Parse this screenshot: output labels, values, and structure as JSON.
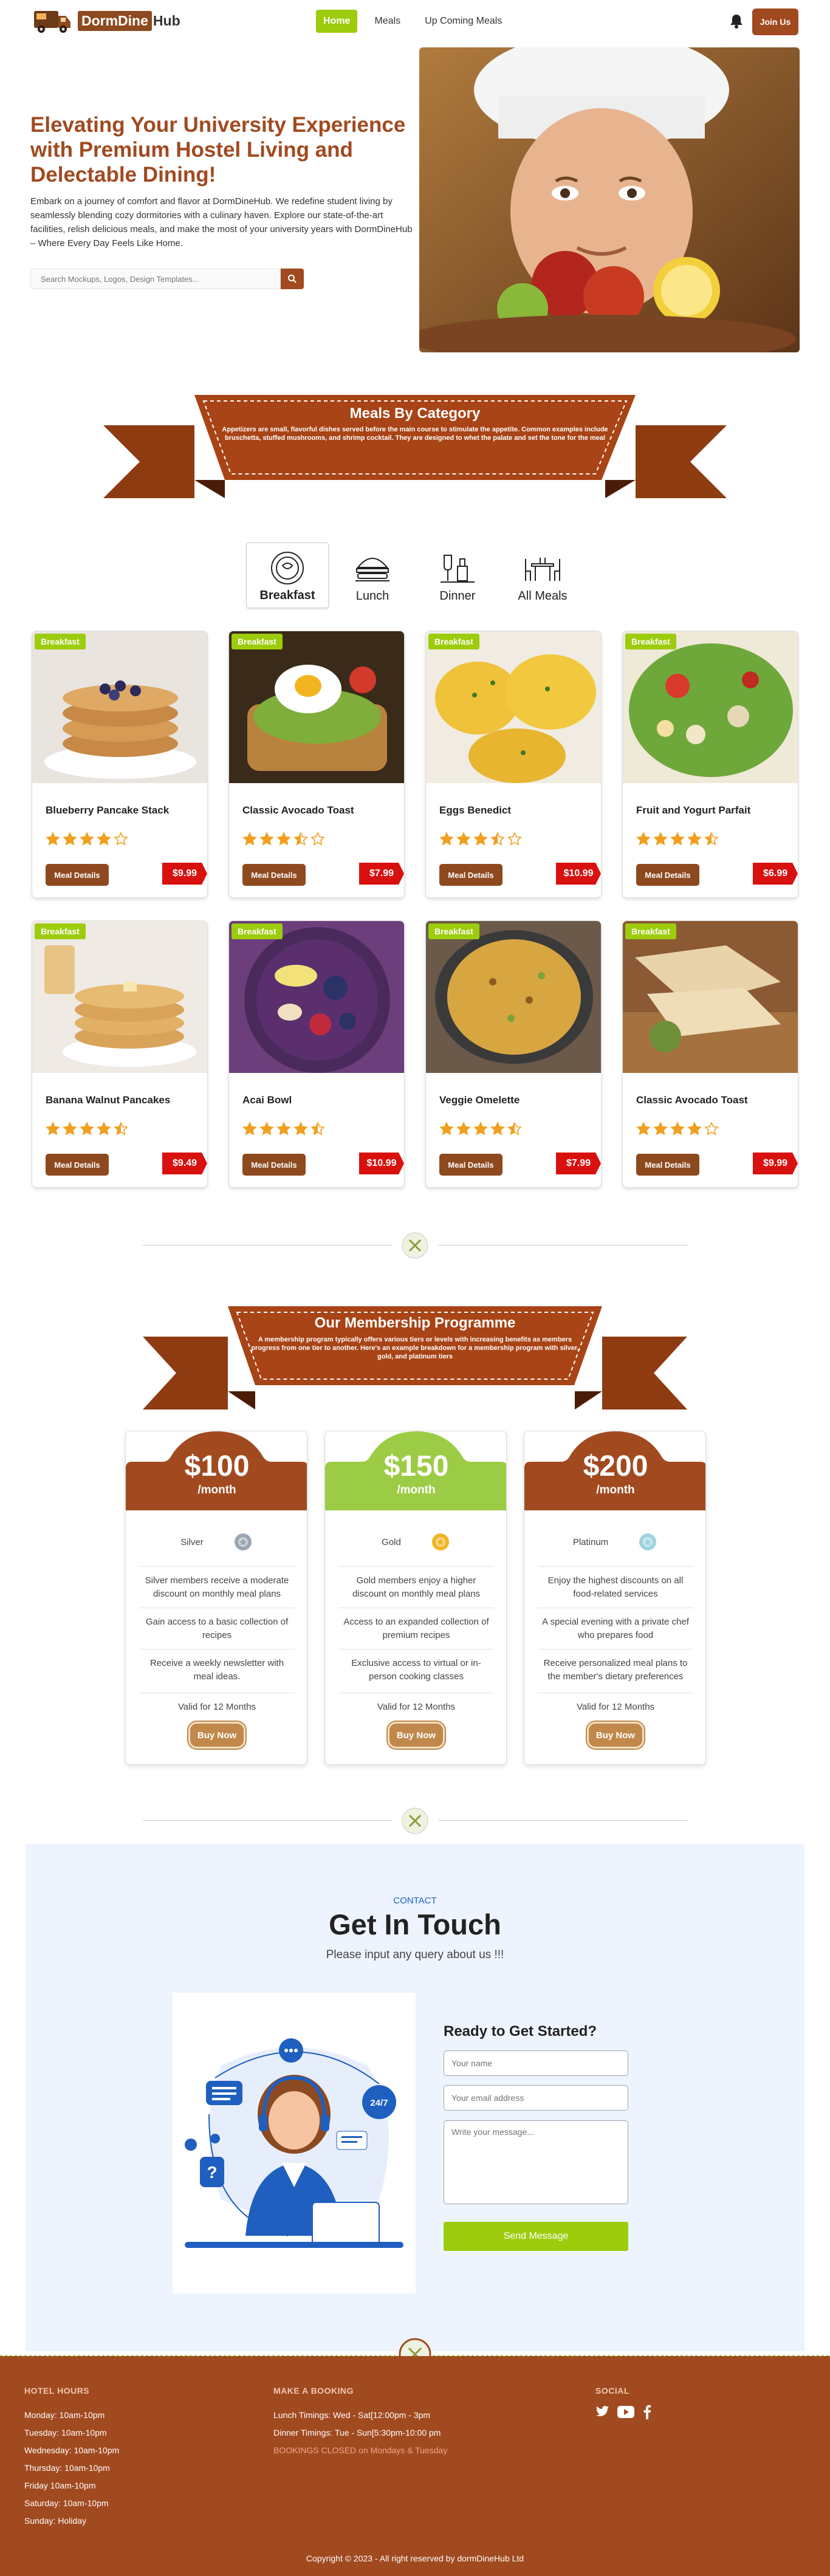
{
  "nav": {
    "brand_part1": "DormDine",
    "brand_part2": "Hub",
    "links": [
      "Home",
      "Meals",
      "Up Coming Meals"
    ],
    "join_label": "Join Us"
  },
  "hero": {
    "title": "Elevating Your University Experience with Premium Hostel Living and Delectable Dining!",
    "description": "Embark on a journey of comfort and flavor at DormDineHub. We redefine student living by seamlessly blending cozy dormitories with a culinary haven. Explore our state-of-the-art facilities, relish delicious meals, and make the most of your university years with DormDineHub – Where Every Day Feels Like Home.",
    "search_placeholder": "Search Mockups, Logos, Design Templates..."
  },
  "category": {
    "title": "Meals By Category",
    "subtitle": "Appetizers are small, flavorful dishes served before the main course to stimulate the appetite. Common examples include bruschetta, stuffed mushrooms, and shrimp cocktail. They are designed to whet the palate and set the tone for the meal",
    "tabs": [
      "Breakfast",
      "Lunch",
      "Dinner",
      "All Meals"
    ]
  },
  "meals": [
    {
      "badge": "Breakfast",
      "title": "Blueberry Pancake Stack",
      "rating": 4,
      "button": "Meal Details",
      "price": "$9.99"
    },
    {
      "badge": "Breakfast",
      "title": "Classic Avocado Toast",
      "rating": 3.5,
      "button": "Meal Details",
      "price": "$7.99"
    },
    {
      "badge": "Breakfast",
      "title": "Eggs Benedict",
      "rating": 3.5,
      "button": "Meal Details",
      "price": "$10.99"
    },
    {
      "badge": "Breakfast",
      "title": "Fruit and Yogurt Parfait",
      "rating": 4.5,
      "button": "Meal Details",
      "price": "$6.99"
    },
    {
      "badge": "Breakfast",
      "title": "Banana Walnut Pancakes",
      "rating": 4.5,
      "button": "Meal Details",
      "price": "$9.49"
    },
    {
      "badge": "Breakfast",
      "title": "Acai Bowl",
      "rating": 4.5,
      "button": "Meal Details",
      "price": "$10.99"
    },
    {
      "badge": "Breakfast",
      "title": "Veggie Omelette",
      "rating": 4.5,
      "button": "Meal Details",
      "price": "$7.99"
    },
    {
      "badge": "Breakfast",
      "title": "Classic Avocado Toast",
      "rating": 4,
      "button": "Meal Details",
      "price": "$9.99"
    }
  ],
  "membership": {
    "title": "Our Membership Programme",
    "subtitle": "A membership program typically offers various tiers or levels with increasing benefits as members progress from one tier to another. Here's an example breakdown for a membership program with silver, gold, and platinum tiers",
    "plans": [
      {
        "price": "$100",
        "per": "/month",
        "tier": "Silver",
        "features": [
          "Silver members receive a moderate discount on monthly meal plans",
          "Gain access to a basic collection of recipes",
          "Receive a weekly newsletter with meal ideas.",
          "Valid for 12 Months"
        ],
        "button": "Buy Now",
        "color": "#a14a20"
      },
      {
        "price": "$150",
        "per": "/month",
        "tier": "Gold",
        "features": [
          "Gold members enjoy a higher discount on monthly meal plans",
          "Access to an expanded collection of premium recipes",
          "Exclusive access to virtual or in-person cooking classes",
          "Valid for 12 Months"
        ],
        "button": "Buy Now",
        "color": "#9ccc45"
      },
      {
        "price": "$200",
        "per": "/month",
        "tier": "Platinum",
        "features": [
          "Enjoy the highest discounts on all food-related services",
          "A special evening with a private chef who prepares food",
          "Receive personalized meal plans to the member's dietary preferences",
          "Valid for 12 Months"
        ],
        "button": "Buy Now",
        "color": "#a14a20"
      }
    ]
  },
  "contact": {
    "kicker": "CONTACT",
    "title": "Get In Touch",
    "subtitle": "Please input any query about us !!!",
    "form_title": "Ready to Get Started?",
    "name_placeholder": "Your name",
    "email_placeholder": "Your email address",
    "message_placeholder": "Write your message...",
    "send_label": "Send Message",
    "badge_text": "24/7"
  },
  "footer": {
    "hours_heading": "HOTEL HOURS",
    "hours": [
      "Monday: 10am-10pm",
      "Tuesday: 10am-10pm",
      "Wednesday: 10am-10pm",
      "Thursday: 10am-10pm",
      "Friday 10am-10pm",
      "Saturday: 10am-10pm",
      "Sunday: Holiday"
    ],
    "booking_heading": "MAKE A BOOKING",
    "booking": [
      "Lunch Timings: Wed - Sat[12:00pm - 3pm",
      "Dinner Timings: Tue - Sun[5:30pm-10:00 pm",
      "BOOKINGS CLOSED on Mondays & Tuesday"
    ],
    "social_heading": "SOCIAL",
    "copyright": "Copyright © 2023 - All right reserved by dormDineHub Ltd"
  },
  "colors": {
    "brand": "#a14a20",
    "accent": "#9ccc0c",
    "price": "#d8110f",
    "contact_bg": "#eef4fd"
  }
}
